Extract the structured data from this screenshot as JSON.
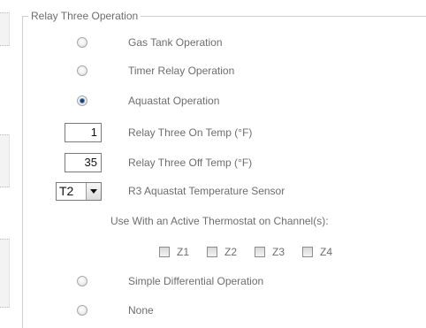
{
  "group": {
    "legend": "Relay Three Operation"
  },
  "options": [
    {
      "label": "Gas Tank Operation",
      "checked": false
    },
    {
      "label": "Timer Relay Operation",
      "checked": false
    },
    {
      "label": "Aquastat Operation",
      "checked": true
    }
  ],
  "temps": {
    "on_value": "1",
    "on_label": "Relay Three On Temp (°F)",
    "off_value": "35",
    "off_label": "Relay Three Off Temp (°F)"
  },
  "sensor": {
    "selected": "T2",
    "label": "R3 Aquastat Temperature Sensor"
  },
  "thermostat": {
    "label": "Use With an Active Thermostat on Channel(s):",
    "zones": [
      "Z1",
      "Z2",
      "Z3",
      "Z4"
    ]
  },
  "more_options": [
    {
      "label": "Simple Differential Operation",
      "checked": false
    },
    {
      "label": "None",
      "checked": false
    }
  ]
}
